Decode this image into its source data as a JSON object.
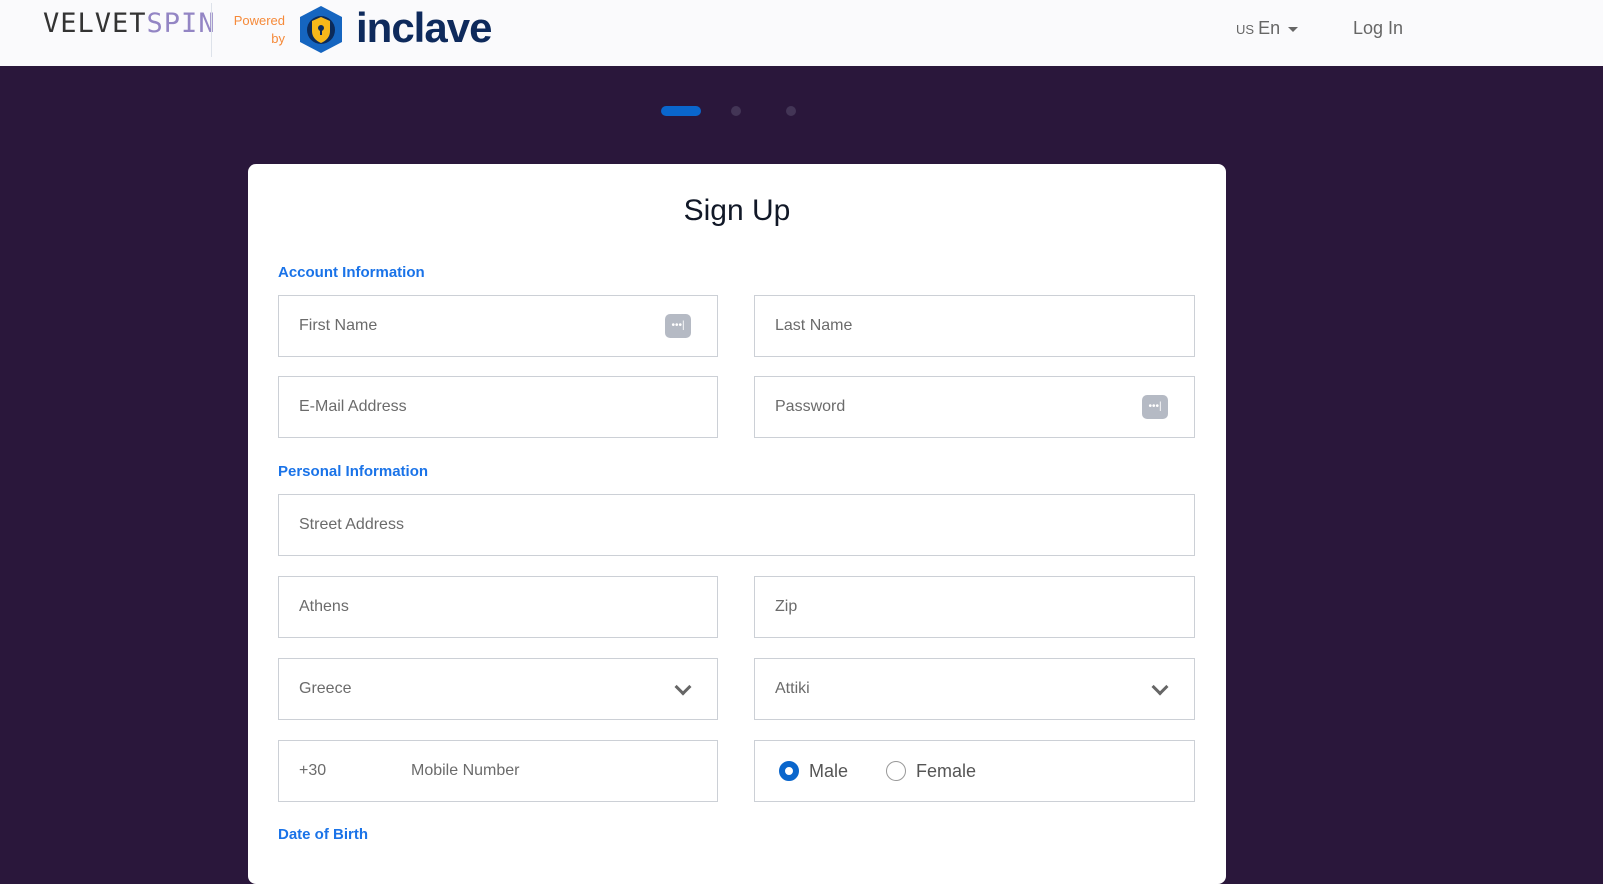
{
  "header": {
    "brand": "VELVET",
    "brand2": "SPIN",
    "powered_by": "Powered by",
    "partner": "inclave",
    "lang_region": "US",
    "lang": "En",
    "login": "Log In"
  },
  "steps": {
    "total": 3,
    "current": 1
  },
  "form": {
    "title": "Sign Up",
    "sections": {
      "account": "Account Information",
      "personal": "Personal Information",
      "dob": "Date of Birth"
    },
    "first_name": "First Name",
    "last_name": "Last Name",
    "email": "E-Mail Address",
    "password": "Password",
    "street": "Street Address",
    "city": "Athens",
    "zip": "Zip",
    "country": "Greece",
    "region": "Attiki",
    "phone_code": "+30",
    "mobile": "Mobile Number",
    "gender": {
      "options": [
        "Male",
        "Female"
      ],
      "selected": "Male"
    }
  },
  "colors": {
    "accent": "#0a66cc",
    "background": "#2a173b",
    "section": "#1a73e8"
  }
}
